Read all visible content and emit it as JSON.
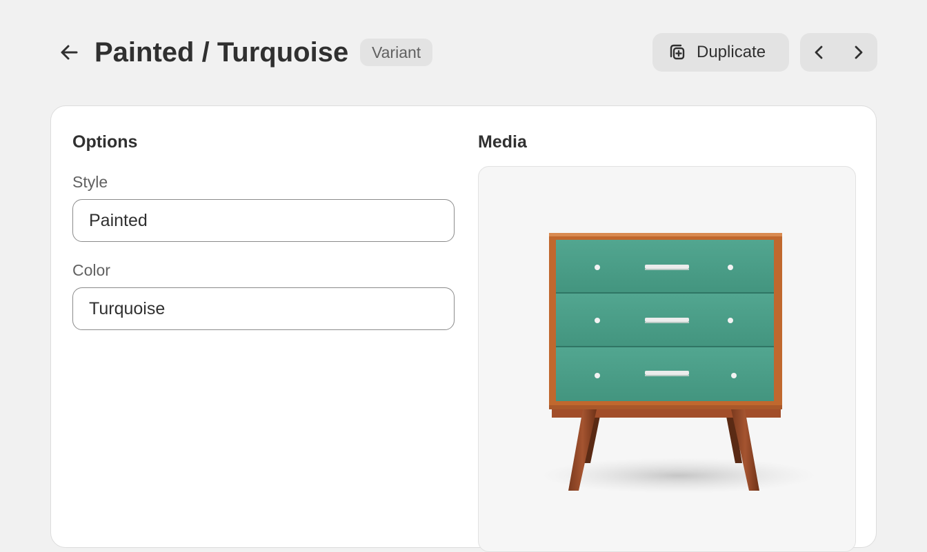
{
  "header": {
    "back_icon": "arrow-left-icon",
    "title": "Painted / Turquoise",
    "badge": "Variant",
    "duplicate_icon": "duplicate-icon",
    "duplicate_label": "Duplicate",
    "prev_icon": "chevron-left-icon",
    "next_icon": "chevron-right-icon"
  },
  "options": {
    "heading": "Options",
    "fields": [
      {
        "label": "Style",
        "value": "Painted"
      },
      {
        "label": "Color",
        "value": "Turquoise"
      }
    ]
  },
  "media": {
    "heading": "Media",
    "image_subject": "turquoise three-drawer wooden dresser"
  },
  "colors": {
    "background": "#f1f1f1",
    "card": "#ffffff",
    "button": "#e3e3e3",
    "text": "#303030",
    "muted_text": "#616161",
    "drawer": "#4a9e89",
    "wood": "#c0682e"
  }
}
